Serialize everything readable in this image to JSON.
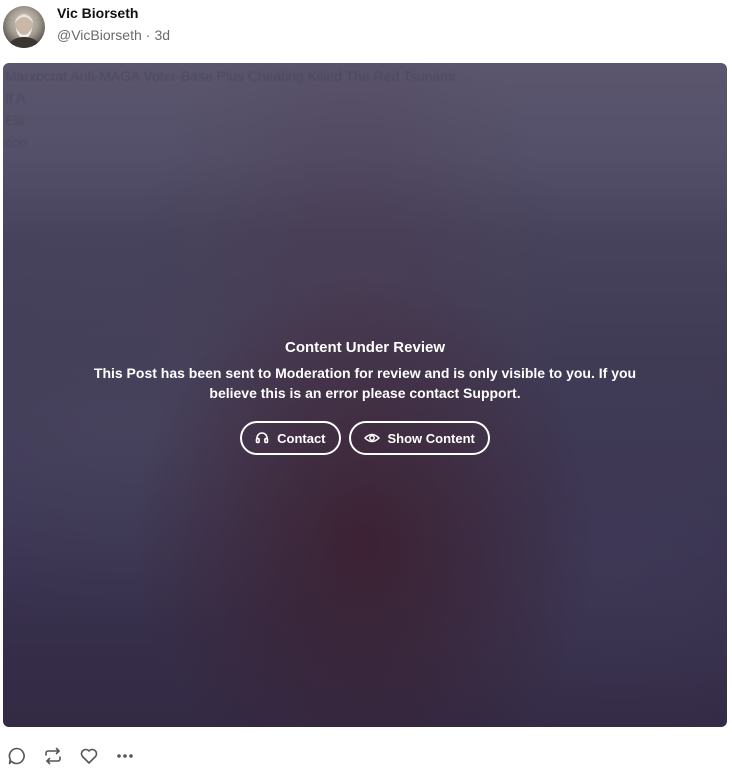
{
  "post": {
    "author_name": "Vic Biorseth",
    "handle": "@VicBiorseth",
    "separator": "·",
    "age": "3d",
    "blurred_lines": [
      "Marxocrat Anti-MAGA Voter-Base Plus Cheating Killed The Red Tsunami",
      "If A",
      "Ele",
      "con"
    ],
    "review": {
      "title": "Content Under Review",
      "message": "This Post has been sent to Moderation for review and is only visible to you. If you believe this is an error please contact Support.",
      "contact_label": "Contact",
      "show_label": "Show Content"
    }
  },
  "actions": {
    "icons": [
      "comment-icon",
      "repost-icon",
      "like-icon",
      "more-icon"
    ]
  },
  "colors": {
    "media_overlay": "#3f3a54",
    "text_primary": "#111111",
    "text_muted": "#6b6b6b"
  }
}
